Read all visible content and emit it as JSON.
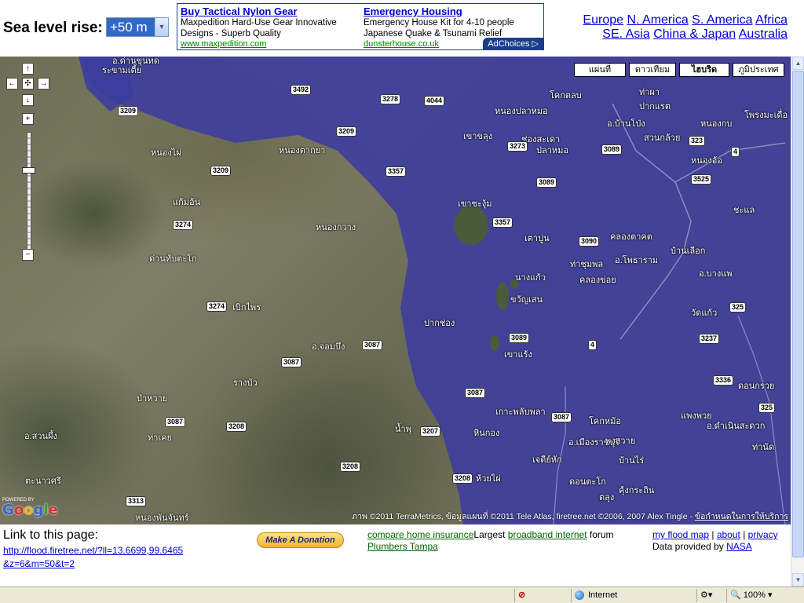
{
  "header": {
    "sea_level_label": "Sea level rise:",
    "sea_level_value": "+50 m"
  },
  "ads": [
    {
      "title": "Buy Tactical Nylon Gear",
      "text": "Maxpedition Hard-Use Gear Innovative Designs - Superb Quality",
      "url": "www.maxpedition.com"
    },
    {
      "title": "Emergency Housing",
      "text": "Emergency House Kit for 4-10 people Japanese Quake & Tsunami Relief",
      "url": "dunsterhouse.co.uk"
    }
  ],
  "adchoices": "AdChoices ▷",
  "regions": [
    "Europe",
    "N. America",
    "S. America",
    "Africa",
    "SE. Asia",
    "China & Japan",
    "Australia"
  ],
  "map": {
    "types": [
      "แผนที่",
      "ดาวเทียม",
      "ไฮบริด",
      "ภูมิประเทศ"
    ],
    "selected_type": "ไฮบริด",
    "places": [
      "อ.ด่านขุนทด",
      "ระขามเตี้ย",
      "หนองไผ่",
      "หนองตากยา",
      "แก้มอ้น",
      "หนองกวาง",
      "ด่านทับตะโก",
      "เบิกไพร",
      "อ.จอมบึง",
      "รางบัว",
      "ป่าหวาย",
      "ท่าเคย",
      "อ.สวนผึ้ง",
      "ตะนาวศรี",
      "หนองพันจันทร์",
      "น้ำพุ",
      "ห้วยไผ่",
      "อ.เมืองราชบุรี",
      "คุ้งกระถิน",
      "ดอนตะโก",
      "เกาะพลับพลา",
      "หินกอง",
      "เตาปูน",
      "นางแก้ว",
      "ปากช่อง",
      "เขาแร้ง",
      "อ.โพธาราม",
      "คลองตาคต",
      "ท่าชุมพล",
      "คลองข่อย",
      "บ้านเลือก",
      "อ.บางแพ",
      "วัดแก้ว",
      "อ.ดำเนินสะดวก",
      "ดอนกรวย",
      "อ.บ้านโป่ง",
      "ท่าผา",
      "ปากแรต",
      "หนองกบ",
      "โพรงมะเดื่อ",
      "สวนกล้วย",
      "หนองอ้อ",
      "ชะแล",
      "ช่องสะเดา",
      "เขาขลุง",
      "เขาชะงุ้ม",
      "ปลาหมอ",
      "โคกตลบ",
      "แพงพวย",
      "โคกหม้อ",
      "พงสวาย",
      "เจดีย์หัก",
      "บ้านไร่",
      "ตลุง",
      "ขวัญเสน",
      "หนองปลาหมอ",
      "ท่านัด"
    ],
    "routes": [
      "3209",
      "3492",
      "3278",
      "4044",
      "3273",
      "3089",
      "323",
      "4",
      "3525",
      "3357",
      "3090",
      "3274",
      "3087",
      "3208",
      "3207",
      "3313",
      "3237",
      "325",
      "3336"
    ],
    "copyright": "ภาพ ©2011 TerraMetrics, ข้อมูลแผนที่ ©2011 Tele Atlas, firetree.net ©2006, 2007 Alex Tingle -",
    "terms_link": "ข้อกำหนดในการให้บริการ",
    "logo": "Google",
    "powered": "POWERED BY"
  },
  "footer": {
    "link_label": "Link to this page:",
    "link_url": "http://flood.firetree.net/?ll=13.6699,99.6465&z=6&m=50&t=2",
    "donate_label": "Make A Donation",
    "ad_link1": "compare home insurance",
    "ad_text1": "Largest",
    "ad_link2": "broadband internet",
    "ad_text2": "forum",
    "ad_link3": "Plumbers Tampa",
    "my_flood_map": "my flood map",
    "about": "about",
    "privacy": "privacy",
    "data_by": "Data provided by",
    "nasa": "NASA"
  },
  "statusbar": {
    "zone": "Internet",
    "zoom": "100%"
  },
  "colors": {
    "flood": "#3d3d9e",
    "link": "#0000cc",
    "ad_link_green": "#006600"
  }
}
